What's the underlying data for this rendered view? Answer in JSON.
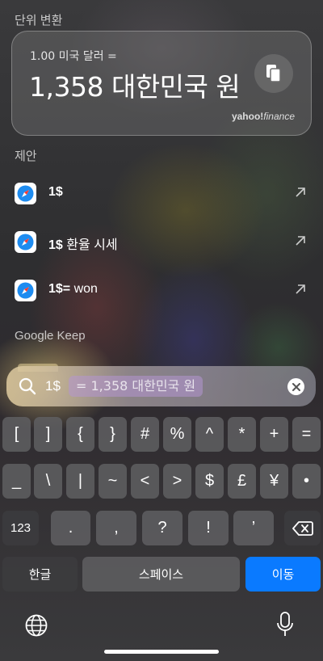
{
  "conversion": {
    "section_label": "단위 변환",
    "from_text": "1.00 미국 달러 =",
    "to_text": "1,358 대한민국 원",
    "brand_main": "yahoo!",
    "brand_sub": "finance",
    "copy_icon": "copy-icon"
  },
  "suggestions": {
    "section_label": "제안",
    "items": [
      {
        "bold": "1$",
        "rest": "",
        "icon": "safari-icon"
      },
      {
        "bold": "1$",
        "rest": " 환율 시세",
        "icon": "safari-icon"
      },
      {
        "bold": "1$=",
        "rest": " won",
        "icon": "safari-icon"
      }
    ]
  },
  "google_keep": {
    "section_label": "Google Keep"
  },
  "search": {
    "query": "1$",
    "completion": "= 1,358 대한민국 원",
    "icon": "search-icon",
    "clear_icon": "clear-icon"
  },
  "keyboard": {
    "row1": [
      "[",
      "]",
      "{",
      "}",
      "#",
      "%",
      "^",
      "*",
      "+",
      "="
    ],
    "row2": [
      "_",
      "\\",
      "|",
      "~",
      "<",
      ">",
      "$",
      "£",
      "¥",
      "•"
    ],
    "row3_mode": "123",
    "row3": [
      ".",
      ",",
      "?",
      "!",
      "’"
    ],
    "bottom_left": "한글",
    "space": "스페이스",
    "go": "이동",
    "go_color": "#0a7aff"
  }
}
